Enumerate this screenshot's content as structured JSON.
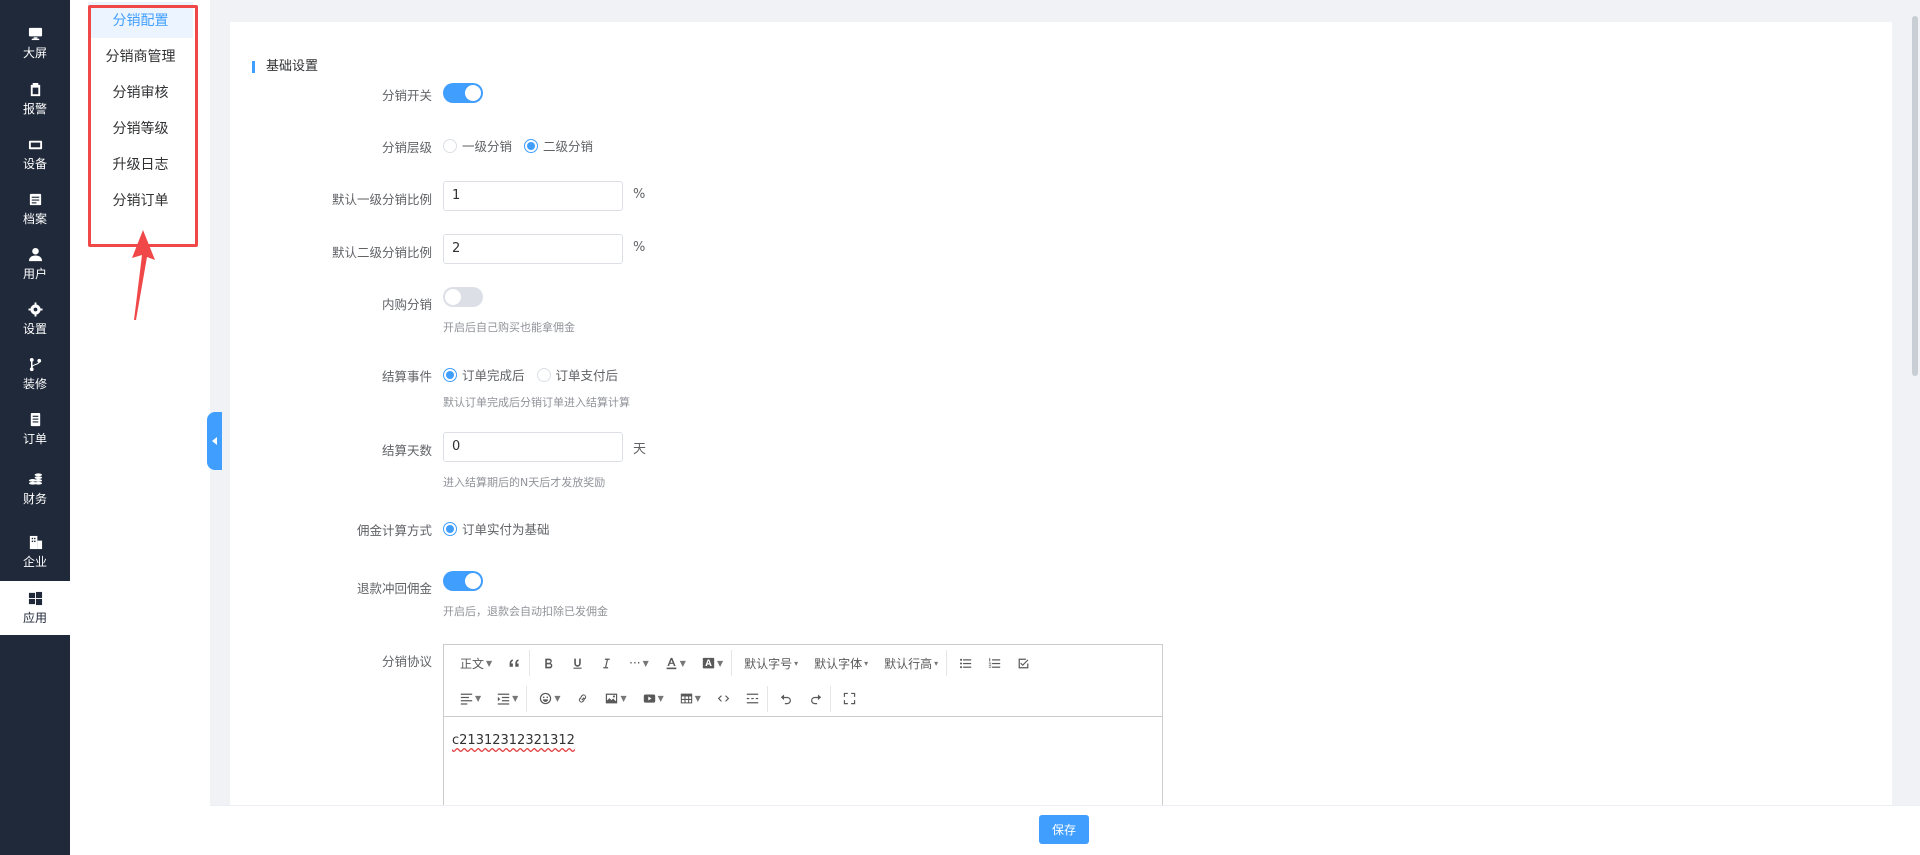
{
  "nav": [
    {
      "label": "大屏",
      "icon": "monitor-icon"
    },
    {
      "label": "报警",
      "icon": "clipboard-icon"
    },
    {
      "label": "设备",
      "icon": "device-icon"
    },
    {
      "label": "档案",
      "icon": "file-icon"
    },
    {
      "label": "用户",
      "icon": "user-icon"
    },
    {
      "label": "设置",
      "icon": "gear-icon"
    },
    {
      "label": "装修",
      "icon": "branch-icon"
    },
    {
      "label": "订单",
      "icon": "order-icon"
    },
    {
      "label": "财务",
      "icon": "coins-icon"
    },
    {
      "label": "企业",
      "icon": "building-icon"
    },
    {
      "label": "应用",
      "icon": "windows-icon",
      "active": true
    }
  ],
  "submenu": [
    {
      "label": "分销配置",
      "active": true
    },
    {
      "label": "分销商管理"
    },
    {
      "label": "分销审核"
    },
    {
      "label": "分销等级"
    },
    {
      "label": "升级日志"
    },
    {
      "label": "分销订单"
    }
  ],
  "section_title": "基础设置",
  "form": {
    "switch_label": "分销开关",
    "switch_on": true,
    "level_label": "分销层级",
    "level_options": [
      "一级分销",
      "二级分销"
    ],
    "level_selected": "二级分销",
    "ratio1_label": "默认一级分销比例",
    "ratio1_value": "1",
    "ratio1_unit": "%",
    "ratio2_label": "默认二级分销比例",
    "ratio2_value": "2",
    "ratio2_unit": "%",
    "inner_label": "内购分销",
    "inner_on": false,
    "inner_hint": "开启后自己购买也能拿佣金",
    "settle_label": "结算事件",
    "settle_options": [
      "订单完成后",
      "订单支付后"
    ],
    "settle_selected": "订单完成后",
    "settle_hint": "默认订单完成后分销订单进入结算计算",
    "days_label": "结算天数",
    "days_value": "0",
    "days_unit": "天",
    "days_hint": "进入结算期后的N天后才发放奖励",
    "commission_label": "佣金计算方式",
    "commission_option": "订单实付为基础",
    "refund_label": "退款冲回佣金",
    "refund_on": true,
    "refund_hint": "开启后，退款会自动扣除已发佣金",
    "agreement_label": "分销协议"
  },
  "editor": {
    "row1": [
      "正文",
      "❝",
      "B",
      "U",
      "I",
      "···",
      "A",
      "A",
      "默认字号",
      "默认字体",
      "默认行高",
      "list-ul",
      "list-ol",
      "todo"
    ],
    "heading": "正文",
    "font_size": "默认字号",
    "font_family": "默认字体",
    "line_height": "默认行高",
    "content": "c21312312321312"
  },
  "save_label": "保存"
}
